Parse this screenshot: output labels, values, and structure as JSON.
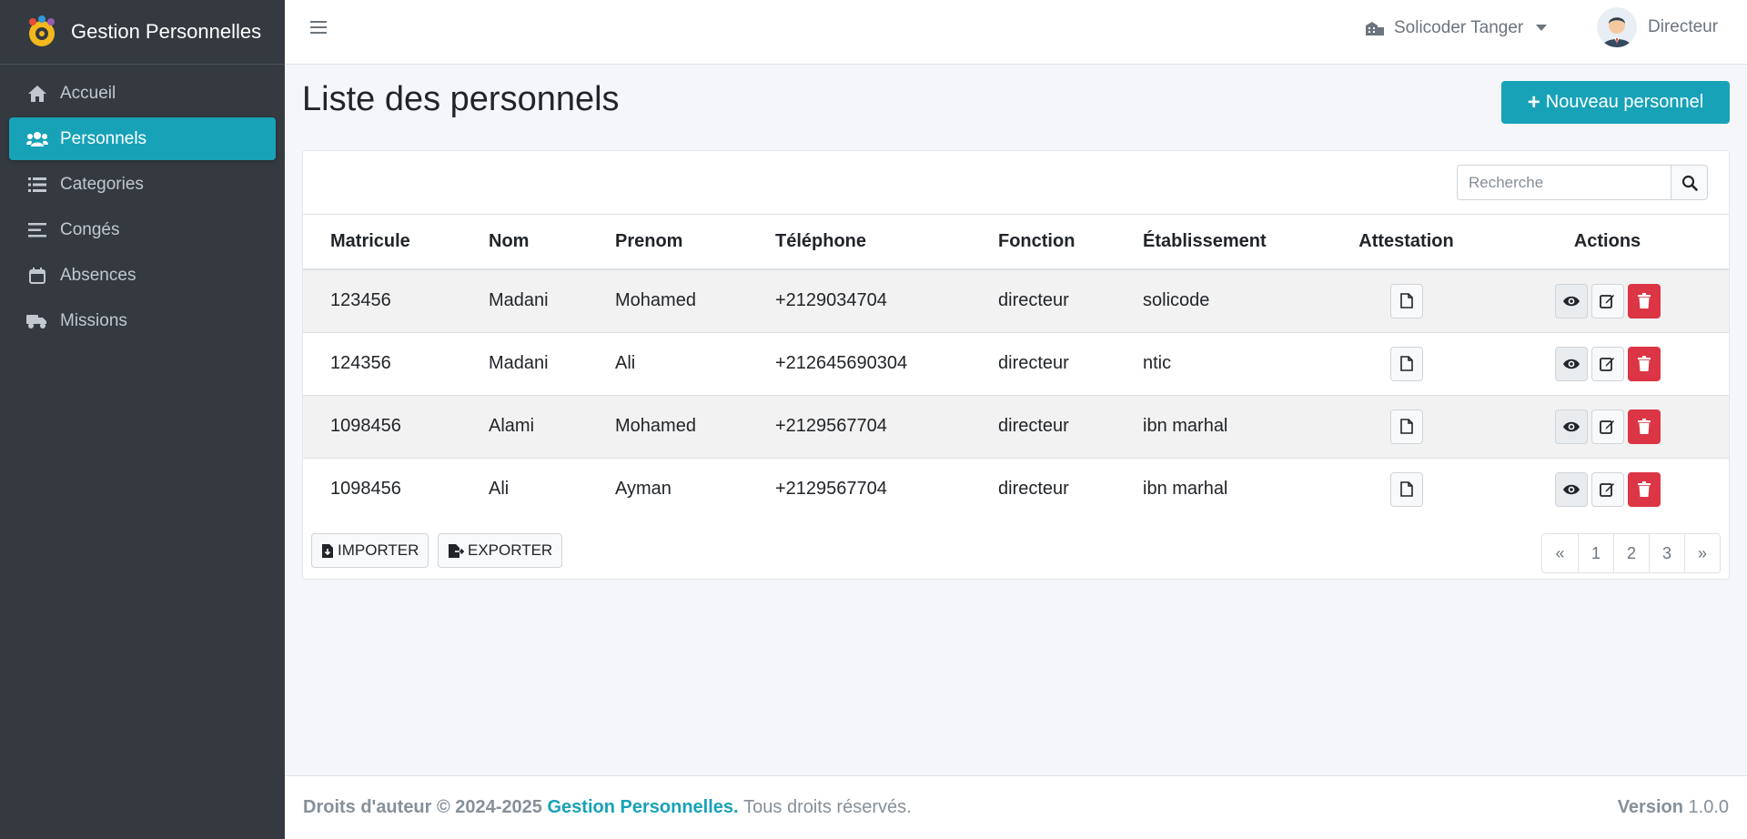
{
  "brand": {
    "name": "Gestion Personnelles"
  },
  "sidebar": {
    "items": [
      {
        "label": "Accueil",
        "icon": "home-icon",
        "active": false
      },
      {
        "label": "Personnels",
        "icon": "users-icon",
        "active": true
      },
      {
        "label": "Categories",
        "icon": "list-icon",
        "active": false
      },
      {
        "label": "Congés",
        "icon": "bars-icon",
        "active": false
      },
      {
        "label": "Absences",
        "icon": "calendar-icon",
        "active": false
      },
      {
        "label": "Missions",
        "icon": "truck-icon",
        "active": false
      }
    ]
  },
  "topbar": {
    "organization": "Solicoder Tanger",
    "user_role": "Directeur"
  },
  "main": {
    "title": "Liste des personnels",
    "new_button": "Nouveau personnel",
    "search_placeholder": "Recherche",
    "table": {
      "headers": [
        "Matricule",
        "Nom",
        "Prenom",
        "Téléphone",
        "Fonction",
        "Établissement",
        "Attestation",
        "Actions"
      ],
      "rows": [
        [
          "123456",
          "Madani",
          "Mohamed",
          "+2129034704",
          "directeur",
          "solicode"
        ],
        [
          "124356",
          "Madani",
          "Ali",
          "+212645690304",
          "directeur",
          "ntic"
        ],
        [
          "1098456",
          "Alami",
          "Mohamed",
          "+2129567704",
          "directeur",
          "ibn marhal"
        ],
        [
          "1098456",
          "Ali",
          "Ayman",
          "+2129567704",
          "directeur",
          "ibn marhal"
        ]
      ]
    },
    "import_label": "IMPORTER",
    "export_label": "EXPORTER",
    "pagination": [
      "«",
      "1",
      "2",
      "3",
      "»"
    ]
  },
  "footer": {
    "copyright": "Droits d'auteur © 2024-2025",
    "brand_link": "Gestion Personnelles.",
    "rights": "Tous droits réservés.",
    "version_label": "Version",
    "version_value": "1.0.0"
  },
  "colors": {
    "accent": "#17a2b8",
    "sidebar": "#343a40",
    "danger": "#dc3545"
  }
}
